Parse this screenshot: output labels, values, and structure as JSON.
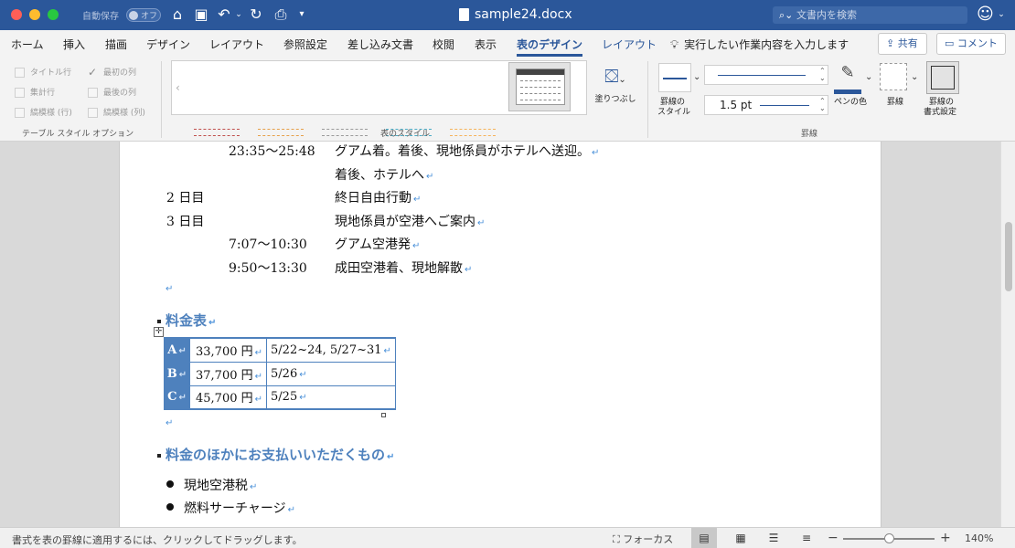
{
  "window": {
    "autosave_label": "自動保存",
    "autosave_state": "オフ",
    "doc_title": "sample24.docx",
    "search_placeholder": "文書内を検索"
  },
  "ribbon_tabs": [
    {
      "label": "ホーム"
    },
    {
      "label": "挿入"
    },
    {
      "label": "描画"
    },
    {
      "label": "デザイン"
    },
    {
      "label": "レイアウト"
    },
    {
      "label": "参照設定"
    },
    {
      "label": "差し込み文書"
    },
    {
      "label": "校閲"
    },
    {
      "label": "表示"
    },
    {
      "label": "表のデザイン"
    },
    {
      "label": "レイアウト"
    }
  ],
  "tell_me": "実行したい作業内容を入力します",
  "share_label": "共有",
  "comment_label": "コメント",
  "style_options": {
    "items": [
      {
        "label": "タイトル行",
        "checked": false
      },
      {
        "label": "最初の列",
        "checked": true
      },
      {
        "label": "集計行",
        "checked": false
      },
      {
        "label": "最後の列",
        "checked": false
      },
      {
        "label": "縞模様 (行)",
        "checked": false
      },
      {
        "label": "縞模様 (列)",
        "checked": false
      }
    ],
    "group_label": "テーブル スタイル オプション"
  },
  "table_styles": {
    "group_label": "表のスタイル",
    "thumb_colors": [
      "#c0504d",
      "#e6a04a",
      "#9a9a9a",
      "#4bacc6",
      "#f6b35a"
    ]
  },
  "shading_label": "塗りつぶし",
  "borders": {
    "pen_style_label_1": "罫線の",
    "pen_style_label_2": "スタイル",
    "pen_weight": "1.5 pt",
    "pen_color_label": "ペンの色",
    "borders_label": "罫線",
    "painter_label_1": "罫線の",
    "painter_label_2": "書式設定",
    "group_label": "罫線",
    "accent": "#2b579a"
  },
  "document": {
    "lines": [
      {
        "time": "23:35～25:48",
        "text": "グアム着。着後、現地係員がホテルへ送迎。"
      },
      {
        "time": "",
        "text": "着後、ホテルへ"
      },
      {
        "day": "2 日目",
        "text": "終日自由行動"
      },
      {
        "day": "3 日目",
        "text": "現地係員が空港へご案内"
      },
      {
        "time": "7:07～10:30",
        "text": "グアム空港発"
      },
      {
        "time": "9:50～13:30",
        "text": "成田空港着、現地解散"
      }
    ],
    "heading_fares": "料金表",
    "fares": [
      {
        "key": "A",
        "price": "33,700 円",
        "dates": "5/22~24, 5/27~31"
      },
      {
        "key": "B",
        "price": "37,700 円",
        "dates": "5/26"
      },
      {
        "key": "C",
        "price": "45,700 円",
        "dates": "5/25"
      }
    ],
    "heading_other": "料金のほかにお支払いいただくもの",
    "bullets": [
      "現地空港税",
      "燃料サーチャージ"
    ],
    "para_mark": "↵",
    "heading_color": "#4e81bd"
  },
  "status": {
    "message": "書式を表の罫線に適用するには、クリックしてドラッグします。",
    "focus_label": "フォーカス",
    "zoom_minus": "−",
    "zoom_plus": "+",
    "zoom": "140%",
    "zoom_fraction": 0.5
  }
}
